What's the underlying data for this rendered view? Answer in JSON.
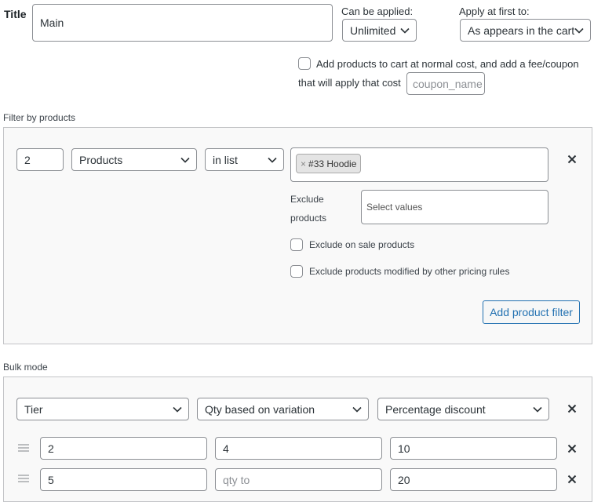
{
  "title": {
    "label": "Title",
    "value": "Main"
  },
  "can_be_applied": {
    "label": "Can be applied:",
    "value": "Unlimited"
  },
  "apply_first": {
    "label": "Apply at first to:",
    "value": "As appears in the cart"
  },
  "normal_cost": {
    "label_line1": "Add products to cart at normal cost, and add a fee/coupon",
    "label_line2": "that will apply that cost",
    "coupon_placeholder": "coupon_name"
  },
  "filter": {
    "section_label": "Filter by products",
    "qty_value": "2",
    "type_value": "Products",
    "method_value": "in list",
    "tag_text": "#33 Hoodie",
    "tag_remove": "×",
    "exclude_label_1": "Exclude",
    "exclude_label_2": "products",
    "exclude_placeholder": "Select values",
    "exclude_on_sale": "Exclude on sale products",
    "exclude_modified": "Exclude products modified by other pricing rules",
    "add_button": "Add product filter"
  },
  "bulk": {
    "section_label": "Bulk mode",
    "mode_value": "Tier",
    "qty_based_value": "Qty based on variation",
    "discount_type_value": "Percentage discount",
    "rows": [
      {
        "from": "2",
        "to": "4",
        "to_placeholder": "",
        "discount": "10"
      },
      {
        "from": "5",
        "to": "",
        "to_placeholder": "qty to",
        "discount": "20"
      }
    ]
  }
}
